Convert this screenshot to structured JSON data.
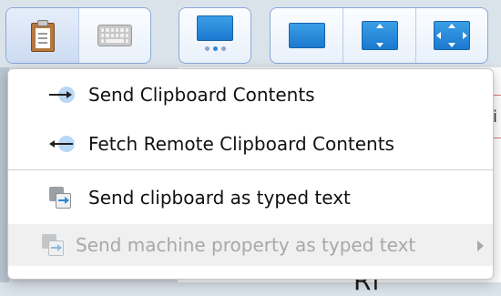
{
  "background": {
    "partial_text": "Ri",
    "alert_glyph": "i"
  },
  "toolbar": {
    "groups": [
      {
        "buttons": [
          "clipboard-icon",
          "keyboard-icon"
        ]
      },
      {
        "buttons": [
          "display-icon"
        ]
      },
      {
        "buttons": [
          "window-icon",
          "fit-vertical-icon",
          "fullscreen-icon"
        ]
      }
    ]
  },
  "menu": {
    "items": [
      {
        "label": "Send Clipboard Contents",
        "icon": "send-arrow-icon",
        "enabled": true
      },
      {
        "label": "Fetch Remote Clipboard Contents",
        "icon": "fetch-arrow-icon",
        "enabled": true
      },
      {
        "label": "Send clipboard as typed text",
        "icon": "typed-text-icon",
        "enabled": true
      },
      {
        "label": "Send machine property as typed text",
        "icon": "typed-text-icon",
        "enabled": false,
        "has_submenu": true
      }
    ]
  },
  "colors": {
    "accent": "#2d88d8",
    "toolbar_border": "#89a8d8",
    "disabled_text": "#a8a8a8"
  }
}
